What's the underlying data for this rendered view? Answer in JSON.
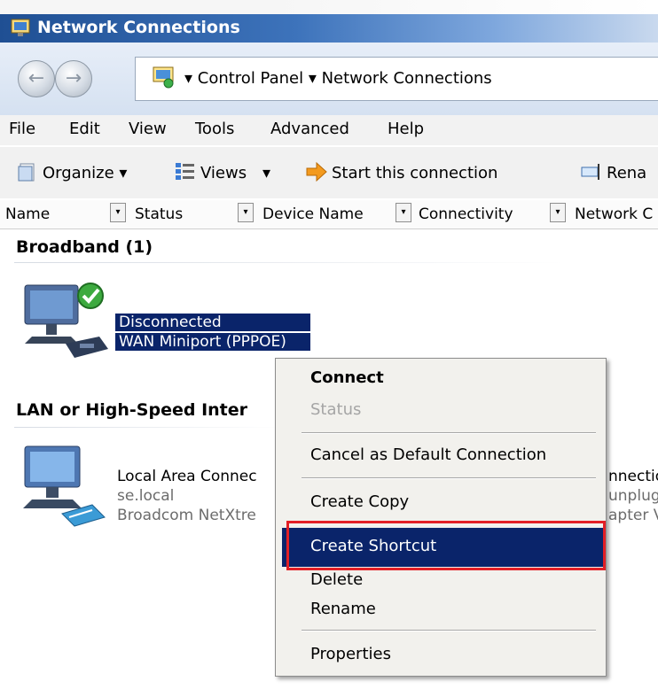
{
  "window": {
    "title": "Network Connections"
  },
  "address": {
    "path": "▾ Control Panel ▾ Network Connections"
  },
  "menu": [
    "File",
    "Edit",
    "View",
    "Tools",
    "Advanced",
    "Help"
  ],
  "toolbar": {
    "organize": "Organize ▾",
    "views": "Views",
    "views_arrow": "▾",
    "start": "Start this connection",
    "rename": "Rena"
  },
  "columns": [
    "Name",
    "Status",
    "Device Name",
    "Connectivity",
    "Network C"
  ],
  "groups": {
    "broadband": {
      "title": "Broadband (1)",
      "item": {
        "status": "Disconnected",
        "device": "WAN Miniport (PPPOE)"
      }
    },
    "lan": {
      "title": "LAN or High-Speed Inter",
      "item": {
        "name": "Local Area Connec",
        "domain": "se.local",
        "device": "Broadcom NetXtre"
      },
      "item2_fragments": [
        "nnectio",
        "unplug",
        "apter V"
      ]
    }
  },
  "context_menu": {
    "connect": "Connect",
    "status": "Status",
    "cancel_default": "Cancel as Default Connection",
    "create_copy": "Create Copy",
    "create_shortcut": "Create Shortcut",
    "delete": "Delete",
    "rename": "Rename",
    "properties": "Properties"
  },
  "colors": {
    "selection": "#0a246a",
    "highlight_box": "#e21f26",
    "titlebar": "#1f4f93"
  }
}
